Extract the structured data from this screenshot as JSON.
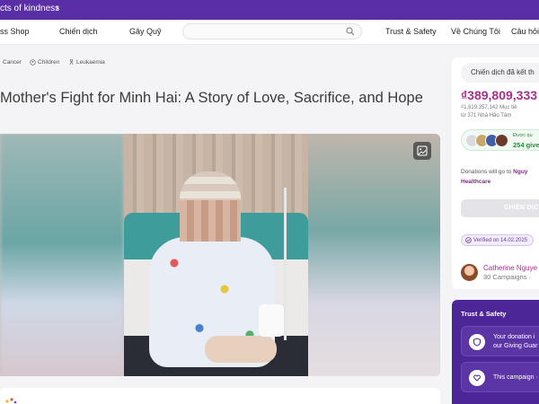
{
  "top_banner": {
    "text": "cts of kindness",
    "icon": "chevron-right-icon"
  },
  "nav": {
    "items": [
      "ss Shop",
      "Chiến dịch",
      "Gây Quỹ",
      "Trust & Safety",
      "Về Chúng Tôi",
      "Câu hỏi"
    ],
    "search_placeholder": "",
    "search_icon": "search-icon"
  },
  "tags": [
    "Cancer",
    "Children",
    "Leukaemia"
  ],
  "title": "Mother's Fight for Minh Hai: A Story of Love, Sacrifice, and Hope",
  "hero": {
    "gallery_icon": "gallery-icon"
  },
  "sidebar": {
    "status": "Chiến dịch đã kết th",
    "amount": "₫389,809,333",
    "target_line1": "₫1,819,357,142 Mục tiê",
    "target_line2": "từ 371 Nhà Hảo Tâm",
    "donors_label": "Được qu",
    "donors_count": "254 giver",
    "dest_line1": "Donations will go to ",
    "dest_org1": "Nguy",
    "dest_org2": "Healthcare",
    "cta": "CHIẾN DỊC",
    "verified": "Verified on 14.02.2025",
    "organizer_name": "Catherine Nguye",
    "organizer_campaigns": "30 Campaigns ·"
  },
  "trust": {
    "heading": "Trust & Safety",
    "items": [
      {
        "line1": "Your donation i",
        "line2": "our Giving Guar",
        "icon": "shield-icon"
      },
      {
        "line1": "This campaign ·",
        "line2": "",
        "icon": "heart-hand-icon"
      }
    ]
  },
  "colors": {
    "brand_purple": "#5a2ea6",
    "amount_magenta": "#a72f8a",
    "trust_bg": "#4c2696"
  }
}
